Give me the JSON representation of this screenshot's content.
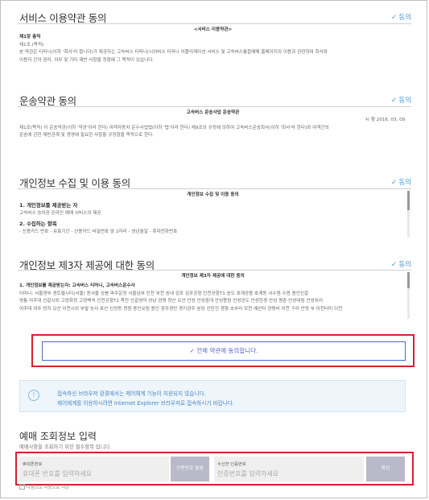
{
  "sections": {
    "service": {
      "title": "서비스 이용약관 동의",
      "agree": "동의",
      "doc_title": "<서비스 이용약관>",
      "chapter": "제1장 총칙",
      "article": "제1조 (목적)",
      "line1": "본 약관은 티머니(이하 '회사'라 합니다)가 제공하는 고속버스 티머니(시외버스 티머니 어플리케이션 서비스 및 고속버스통합예매 홈페이지의 이용과 관련하여 회사와",
      "line2": "이용자 간의 권리, 의무 및 기타 제반 사항을 정함에 그 목적이 있습니다."
    },
    "transport": {
      "title": "운송약관 동의",
      "agree": "동의",
      "doc_title": "고속버스 운송사업 운송약관",
      "date": "시 행 2016. 03. 09.",
      "line1": "제1조(목적) 이 운송약관(이하 '약관'이라 한다) 여객자동차 운수사업법(이하 '법'이라 한다) 제9조의 규정에 의하여 고속버스운송회사(이하 '회사'라 한다)와 여객간의",
      "line2": "운송에 관한 제반관계 및 경영에 필요한 사항을 규정함을 목적으로 한다."
    },
    "privacy": {
      "title": "개인정보 수집 및 이용 동의",
      "agree": "동의",
      "doc_title": "개인정보 수집 및 이용 동의",
      "item1": "1. 개인정보를 제공받는 자",
      "item1_text": "고속버스 승차권 온라인 예매 서비스의 제공",
      "item2": "2. 수집하는 항목",
      "item2_text": "- 신용카드 번호 - 유효기간 - 신용카드 비밀번호 앞 2자리 - 생년월일 - 휴대전화번호"
    },
    "third_party": {
      "title": "개인정보 제3자 제공에 대한 동의",
      "agree": "동의",
      "doc_title": "개인정보 제3자 제공에 대한 동의",
      "item1": "1. 개인정보를 제공받는자: 고속버스 티머니, 고속버스운수사",
      "line1": "티머니: 서울경부 센트럴시티(서울) 동서울 상봉 파주운정 서울남부 인천 부천 송내 김포 김포공항 인천공항T1 송도 호계공용 호계동 서수원 수원 용인신갈",
      "line2": "영통 아주대 신갈시외 고양화정 고양백석 인천공항T2 죽전 신갈영덕 성남 광명 청산 오산 안성 안성중대 안성풍림 안성공도 안성한경 안성 평촌 안성대림 안성외리",
      "line3": "여주대 여주 양지 오산 이천시외 부발 능서 호산 신정동 청원 용인유림 용인 광주경안 경기광주 분당 신탄진 경향 초부리 모현 예산터 양평비 이천 구리 안양 부 이천터미 이천"
    }
  },
  "all_agree": "전체 약관에 동의합니다.",
  "check_glyph": "✓",
  "notice": {
    "icon": "!",
    "line1": "접속하신 브라우저 환경에서는 제어체계 기능이 지원되지 않습니다.",
    "line2": "제어체계를 이용하시려면 Internet Explorer 브라우저로 접속하시기 바랍니다."
  },
  "reservation": {
    "title": "예매 조회정보 입력",
    "subtitle": "예매사항을 조회하기 위한 필수항목 입니다.",
    "phone_label": "휴대폰번호",
    "phone_placeholder": "휴대폰 번호를 입력하세요",
    "send_button": "인증번호 발송",
    "code_label": "수신한 인증번호",
    "code_placeholder": "인증번호를 입력하세요",
    "confirm_button": "확인",
    "save_option": "다음으로 자동으로 저장"
  },
  "colors": {
    "accent": "#4a9bd8",
    "highlight": "#d6212f",
    "button_border": "#5565c8"
  }
}
